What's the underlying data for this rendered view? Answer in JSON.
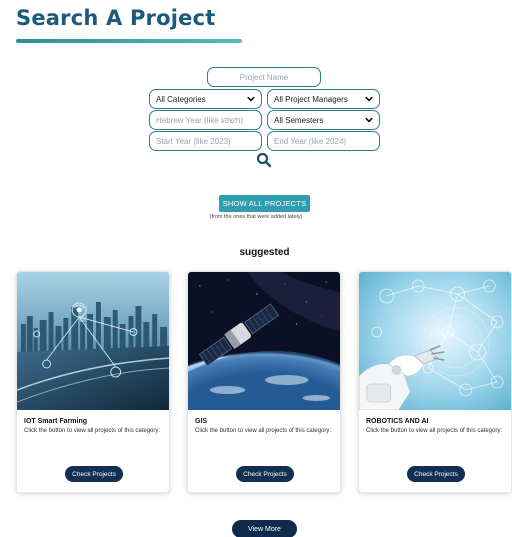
{
  "header": {
    "title": "Search A Project"
  },
  "search": {
    "project_name_placeholder": "Project Name",
    "category_value": "All Categories",
    "manager_value": "All Project Managers",
    "hebrew_year_placeholder": "Hebrew Year (like תשפג)",
    "semester_value": "All Semesters",
    "start_year_placeholder": "Start Year (like 2023)",
    "end_year_placeholder": "End Year (like 2024)",
    "search_icon": "search-icon"
  },
  "show_all": {
    "label": "SHOW ALL PROJECTS",
    "note": "(from the ones that were added lately)"
  },
  "suggested": {
    "heading": "suggested",
    "cards": [
      {
        "title": "IOT Smart Farming",
        "description": "Click the button to view all projects of this category:",
        "button": "Check Projects"
      },
      {
        "title": "GIS",
        "description": "Click the button to view all projects of this category:",
        "button": "Check Projects"
      },
      {
        "title": "ROBOTICS AND AI",
        "description": "Click the button to view all projects of this category:",
        "button": "Check Projects"
      }
    ]
  },
  "view_more": {
    "label": "View More"
  },
  "colors": {
    "title": "#1c5a7d",
    "accent": "#2e9eb0",
    "button_dark": "#132f52",
    "field_border": "#2a7f8a"
  }
}
